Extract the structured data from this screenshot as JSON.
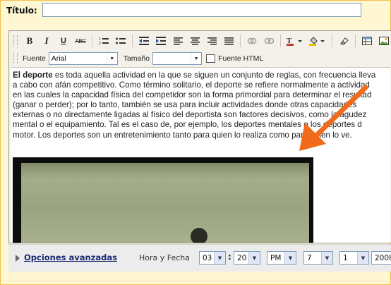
{
  "title_field": {
    "label": "Título:",
    "value": ""
  },
  "toolbar": {
    "bold": "B",
    "italic": "I",
    "underline": "U",
    "strikethrough": "ABC",
    "font_label": "Fuente",
    "font_value": "Arial",
    "size_label": "Tamaño",
    "size_value": "",
    "html_label": "Fuente HTML"
  },
  "content": {
    "bold_word": "El deporte",
    "lines": [
      " es toda aquella actividad en la que se siguen un conjunto de reglas, con frecuencia lleva",
      "a cabo con afán competitivo. Como término solitario, el deporte se refiere normalmente a actividad",
      "en las cuales la capacidad física del competidor son la forma primordial para determinar el resultad",
      "(ganar o perder); por lo tanto, también se usa para incluir actividades donde otras capacidades",
      "externas o no directamente ligadas al físico del deportista son factores decisivos, como la agudez",
      "mental o el equipamiento. Tal es el caso de, por ejemplo, los deportes mentales o los deportes d",
      "motor. Los deportes son un entretenimiento tanto para quien lo realiza como para quien lo ve."
    ]
  },
  "bottom_bar": {
    "advanced_options": "Opciones avanzadas",
    "datetime_label": "Hora y Fecha",
    "hour": "03",
    "minute": "20",
    "ampm": "PM",
    "day": "7",
    "month": "1",
    "year": "2008"
  },
  "colors": {
    "background": "#FFF7D2",
    "border": "#F0C14B",
    "arrow": "#F26B1D",
    "link": "#1A2A73"
  }
}
